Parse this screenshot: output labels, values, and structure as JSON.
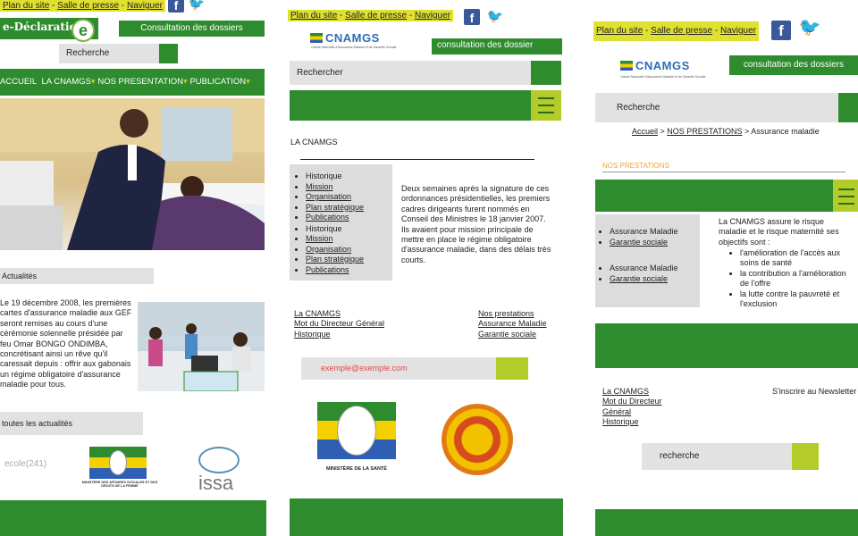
{
  "common": {
    "top_links": [
      "Plan du site",
      "Salle de presse",
      "Naviguer"
    ],
    "sep": " - ",
    "fb": "f",
    "tw": "🐦"
  },
  "col1": {
    "edecl": "e-Déclaration",
    "edecl_e": "e",
    "consult": "Consultation des dossiers",
    "search": "Recherche",
    "nav": [
      "ACCUEIL",
      "LA CNAMGS",
      "NOS PRESENTATION",
      "PUBLICATION"
    ],
    "actualites": "Actualités",
    "news_text": "Le 19 décembre 2008, les premières cartes d'assurance maladie aux GEF seront remises au cours d'une cérémonie solennelle présidée par feu Omar BONGO ONDIMBA, concrétisant ainsi un rêve qu'il caressait depuis : offrir aux gabonais un régime obligatoire d'assurance maladie pour tous.",
    "all_news": "toutes les actualités",
    "partner1": "ecole(241)",
    "partner2": "MINISTÈRE DES AFFAIRES SOCIALES ET DES DROITS DE LA FEMME",
    "partner3": "issa"
  },
  "col2": {
    "logo": "CNAMGS",
    "logo_sub": "Caisse Nationale d'Assurance Maladie et de Garantie Sociale",
    "consult": "consultation des dossier",
    "search": "Rechercher",
    "section": "LA CNAMGS",
    "list1": [
      "Historique",
      "Mission",
      "Organisation",
      "Plan stratégique",
      "Publications"
    ],
    "list2": [
      "Historique",
      "Mission",
      "Organisation",
      "Plan stratégique",
      "Publications"
    ],
    "body": "Deux semaines après la signature de ces ordonnances présidentielles, les premiers cadres dirigeants furent nommés en Conseil des Ministres le 18 janvier 2007. Ils avaient pour mission principale de mettre en place le régime obligatoire d'assurance maladie, dans des délais très courts.",
    "foot_left": [
      "La CNAMGS",
      "Mot du Directeur Général",
      "Historique"
    ],
    "foot_right": [
      "Nos prestations",
      "Assurance Maladie",
      "Garantie sociale"
    ],
    "email": "exemple@exemple.com",
    "ministry": "MINISTÈRE DE LA SANTÉ"
  },
  "col3": {
    "logo": "CNAMGS",
    "logo_sub": "Caisse Nationale d'Assurance Maladie et de Garantie Sociale",
    "consult": "consultation des dossiers",
    "search": "Recherche",
    "breadcrumb": [
      "Accueil",
      " > ",
      "NOS PRESTATIONS",
      " > Assurance maladie"
    ],
    "section": "NOS PRESTATIONS",
    "list1": [
      "Assurance Maladie",
      "Garantie sociale"
    ],
    "list2": [
      "Assurance Maladie",
      "Garantie sociale"
    ],
    "intro": "La CNAMGS assure le risque maladie et le risque maternité ses objectifs sont :",
    "goals": [
      "l'amélioration de l'accès aux soins de santé",
      "la contribution a l'amélioration de l'offre",
      "la lutte contre la pauvreté et l'exclusion"
    ],
    "foot_left": [
      "La CNAMGS",
      "Mot du Directeur Général",
      "Historique"
    ],
    "newsletter": "S'inscrire au Newsletter",
    "search2": "recherche"
  }
}
